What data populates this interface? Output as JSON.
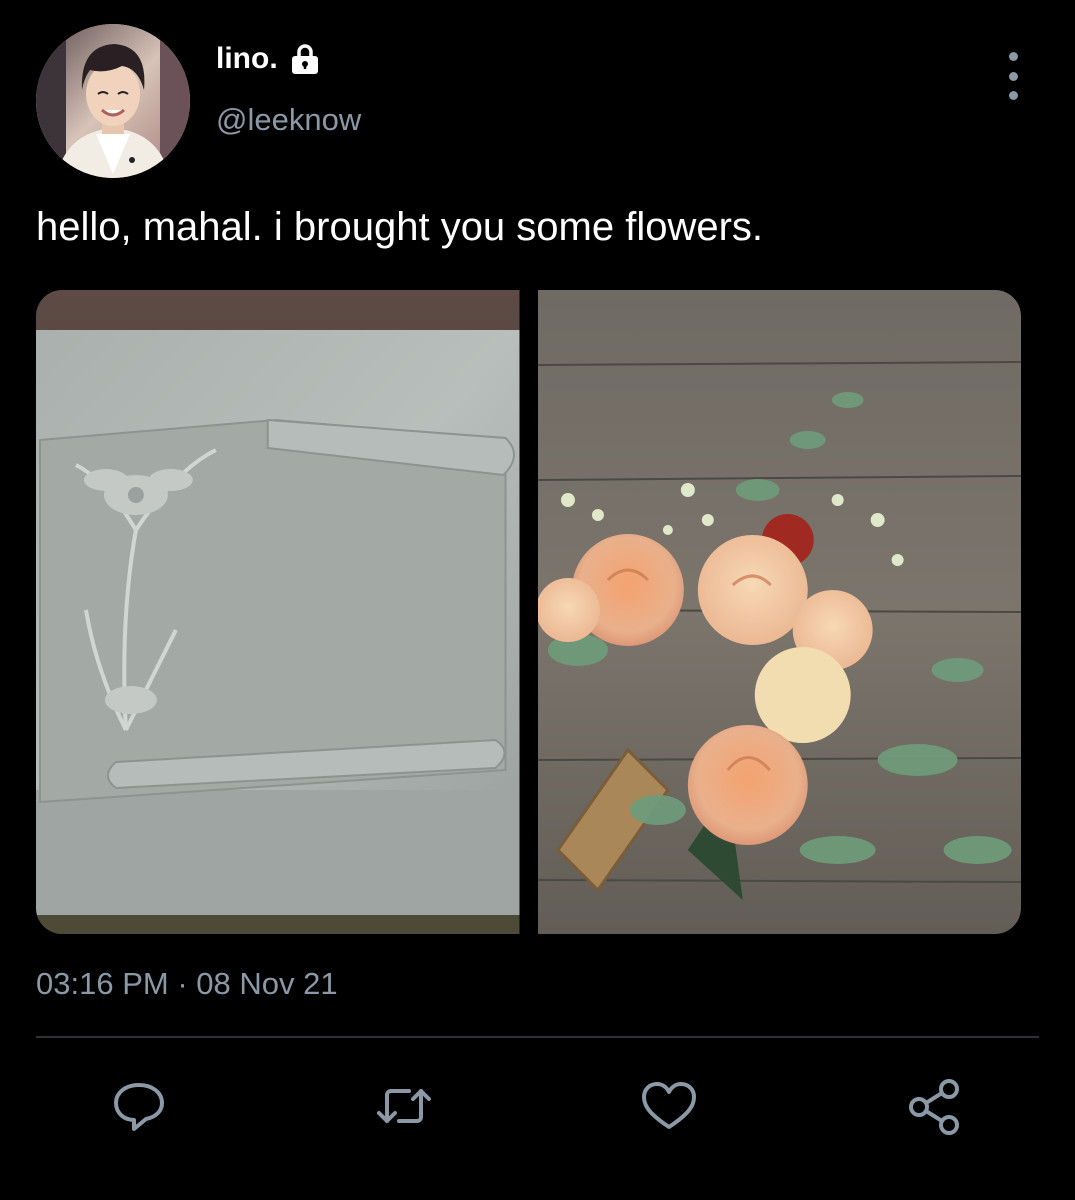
{
  "author": {
    "display_name": "lino.",
    "handle": "@leeknow",
    "verified_lock_icon": "lock-icon",
    "avatar_icon": "avatar"
  },
  "tweet": {
    "text": "hello, mahal. i brought you some flowers.",
    "time": "03:16 PM",
    "separator": "·",
    "date": "08 Nov 21"
  },
  "media": [
    {
      "name": "gravestone-photo",
      "description_icon": "image"
    },
    {
      "name": "flower-bouquet-photo",
      "description_icon": "image"
    }
  ],
  "actions": {
    "reply_icon": "reply-icon",
    "retweet_icon": "retweet-icon",
    "like_icon": "heart-icon",
    "share_icon": "share-icon",
    "more_icon": "more-vertical-icon"
  },
  "colors": {
    "background": "#000000",
    "text_primary": "#ffffff",
    "text_secondary": "#8b98a5",
    "divider": "#2f3336"
  }
}
